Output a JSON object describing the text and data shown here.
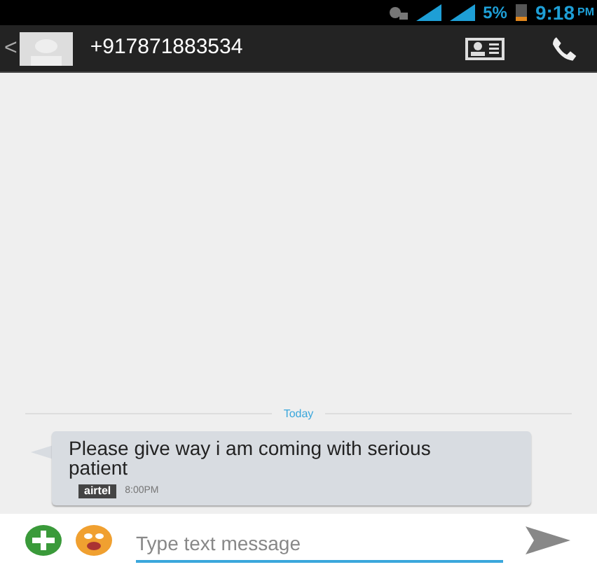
{
  "status_bar": {
    "battery": "5%",
    "time": "9:18",
    "ampm": "PM"
  },
  "header": {
    "back": "<",
    "contact": "+917871883534"
  },
  "conversation": {
    "date_divider": "Today",
    "messages": [
      {
        "text": "Please give way i am coming with serious patient",
        "sim": "airtel",
        "time": "8:00PM"
      }
    ]
  },
  "composer": {
    "placeholder": "Type text message"
  }
}
